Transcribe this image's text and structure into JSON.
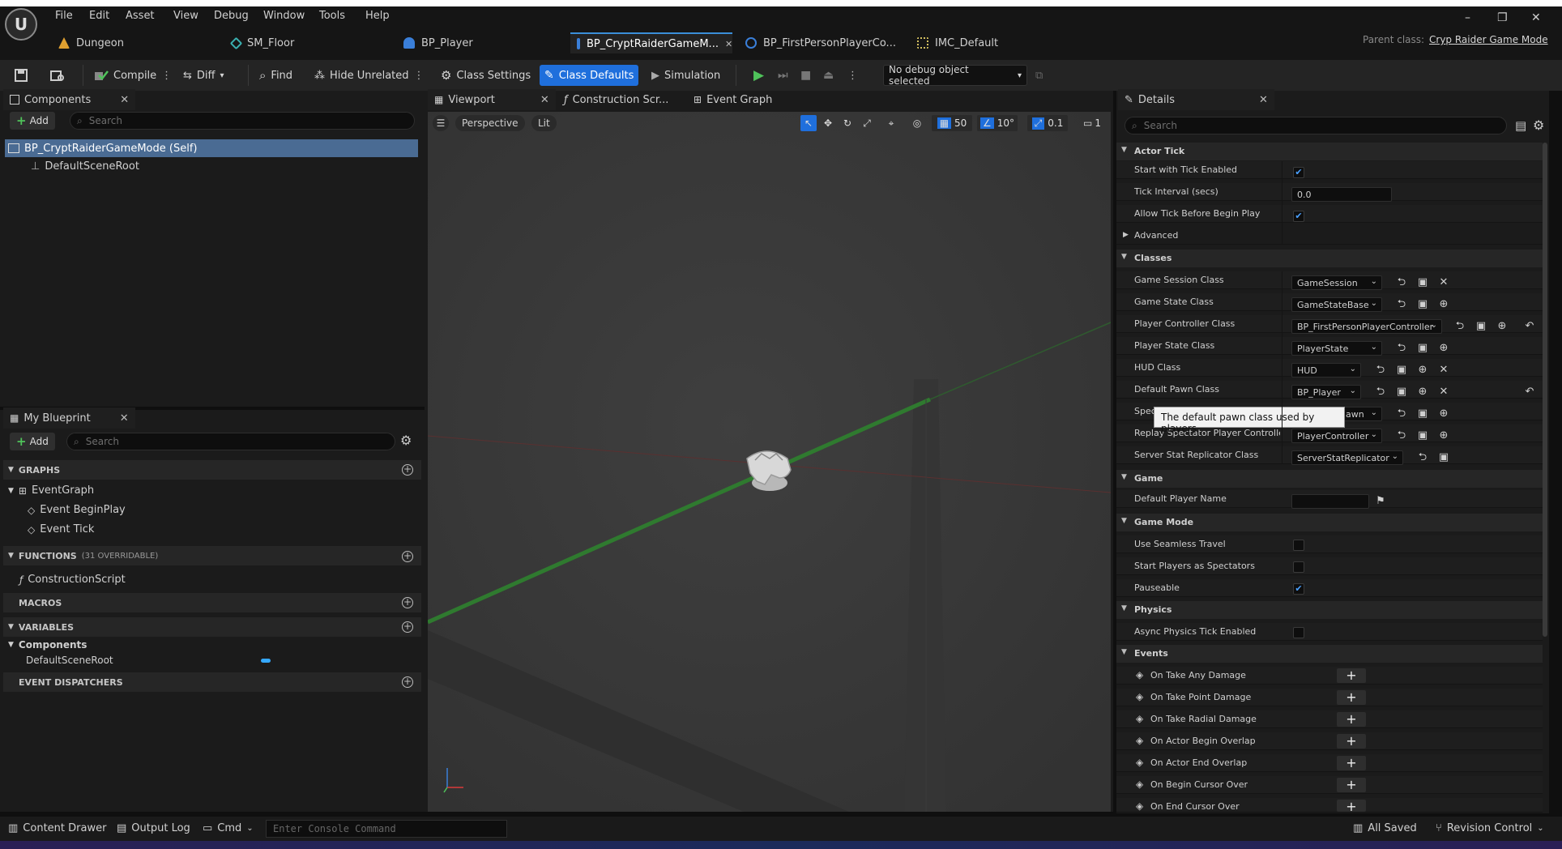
{
  "app": {
    "logo": "U"
  },
  "menu": [
    "File",
    "Edit",
    "Asset",
    "View",
    "Debug",
    "Window",
    "Tools",
    "Help"
  ],
  "window_controls": {
    "minimize": "–",
    "restore": "❐",
    "close": "✕"
  },
  "tabs": [
    {
      "label": "Dungeon",
      "icon": "level-icon",
      "color": "#e0a030"
    },
    {
      "label": "SM_Floor",
      "icon": "static-mesh-icon",
      "color": "#3ab0b0"
    },
    {
      "label": "BP_Player",
      "icon": "pawn-icon",
      "color": "#3a7fd9"
    },
    {
      "label": "BP_CryptRaiderGameM...",
      "icon": "blueprint-icon",
      "color": "#3a7fd9",
      "active": true,
      "close": "✕"
    },
    {
      "label": "BP_FirstPersonPlayerCo...",
      "icon": "controller-icon",
      "color": "#3a7fd9"
    },
    {
      "label": "IMC_Default",
      "icon": "input-icon",
      "color": "#d4c060"
    }
  ],
  "parent_class": {
    "label": "Parent class:",
    "value": "Cryp Raider Game Mode"
  },
  "toolbar": {
    "compile": "Compile",
    "diff": "Diff",
    "find": "Find",
    "hide_unrelated": "Hide Unrelated",
    "class_settings": "Class Settings",
    "class_defaults": "Class Defaults",
    "simulation": "Simulation",
    "debug_object": "No debug object selected"
  },
  "components_panel": {
    "tab": "Components",
    "add": "Add",
    "search_placeholder": "Search",
    "items": [
      {
        "label": "BP_CryptRaiderGameMode (Self)"
      },
      {
        "label": "DefaultSceneRoot"
      }
    ]
  },
  "my_blueprint": {
    "tab": "My Blueprint",
    "add": "Add",
    "search_placeholder": "Search",
    "graphs_header": "GRAPHS",
    "event_graph": "EventGraph",
    "events": [
      "Event BeginPlay",
      "Event Tick"
    ],
    "functions_header": "FUNCTIONS",
    "functions_count": "(31 OVERRIDABLE)",
    "construction_script": "ConstructionScript",
    "macros_header": "MACROS",
    "variables_header": "VARIABLES",
    "components_group": "Components",
    "default_scene_root": "DefaultSceneRoot",
    "dispatchers_header": "EVENT DISPATCHERS"
  },
  "center_tabs": {
    "viewport": "Viewport",
    "construction": "Construction Scr...",
    "event_graph": "Event Graph"
  },
  "viewport": {
    "perspective": "Perspective",
    "lit": "Lit",
    "grid_snap": "50",
    "rot_snap": "10°",
    "scale_snap": "0.1",
    "camera_speed": "1"
  },
  "details": {
    "tab": "Details",
    "search_placeholder": "Search",
    "categories": {
      "actor_tick": "Actor Tick",
      "advanced": "Advanced",
      "classes": "Classes",
      "game": "Game",
      "game_mode": "Game Mode",
      "physics": "Physics",
      "events": "Events"
    },
    "actor_tick": {
      "start_with_tick": "Start with Tick Enabled",
      "start_with_tick_checked": true,
      "tick_interval": "Tick Interval (secs)",
      "tick_interval_value": "0.0",
      "allow_tick": "Allow Tick Before Begin Play",
      "allow_tick_checked": true
    },
    "classes": [
      {
        "label": "Game Session Class",
        "value": "GameSession"
      },
      {
        "label": "Game State Class",
        "value": "GameStateBase"
      },
      {
        "label": "Player Controller Class",
        "value": "BP_FirstPersonPlayerController"
      },
      {
        "label": "Player State Class",
        "value": "PlayerState"
      },
      {
        "label": "HUD Class",
        "value": "HUD"
      },
      {
        "label": "Default Pawn Class",
        "value": "BP_Player"
      },
      {
        "label": "Spec",
        "value": "awn"
      },
      {
        "label": "Replay Spectator Player Controlle...",
        "value": "PlayerController"
      },
      {
        "label": "Server Stat Replicator Class",
        "value": "ServerStatReplicator"
      }
    ],
    "game": {
      "default_player_name": "Default Player Name"
    },
    "game_mode": [
      {
        "label": "Use Seamless Travel",
        "checked": false
      },
      {
        "label": "Start Players as Spectators",
        "checked": false
      },
      {
        "label": "Pauseable",
        "checked": true
      }
    ],
    "physics": {
      "async": "Async Physics Tick Enabled",
      "checked": false
    },
    "events": [
      "On Take Any Damage",
      "On Take Point Damage",
      "On Take Radial Damage",
      "On Actor Begin Overlap",
      "On Actor End Overlap",
      "On Begin Cursor Over",
      "On End Cursor Over"
    ],
    "tooltip": "The default pawn class used by players."
  },
  "bottom": {
    "content_drawer": "Content Drawer",
    "output_log": "Output Log",
    "cmd": "Cmd",
    "console_placeholder": "Enter Console Command",
    "all_saved": "All Saved",
    "revision_control": "Revision Control"
  },
  "colors": {
    "accent": "#1f6fdc",
    "bg": "#1b1b1b",
    "play": "#4fc35a"
  }
}
